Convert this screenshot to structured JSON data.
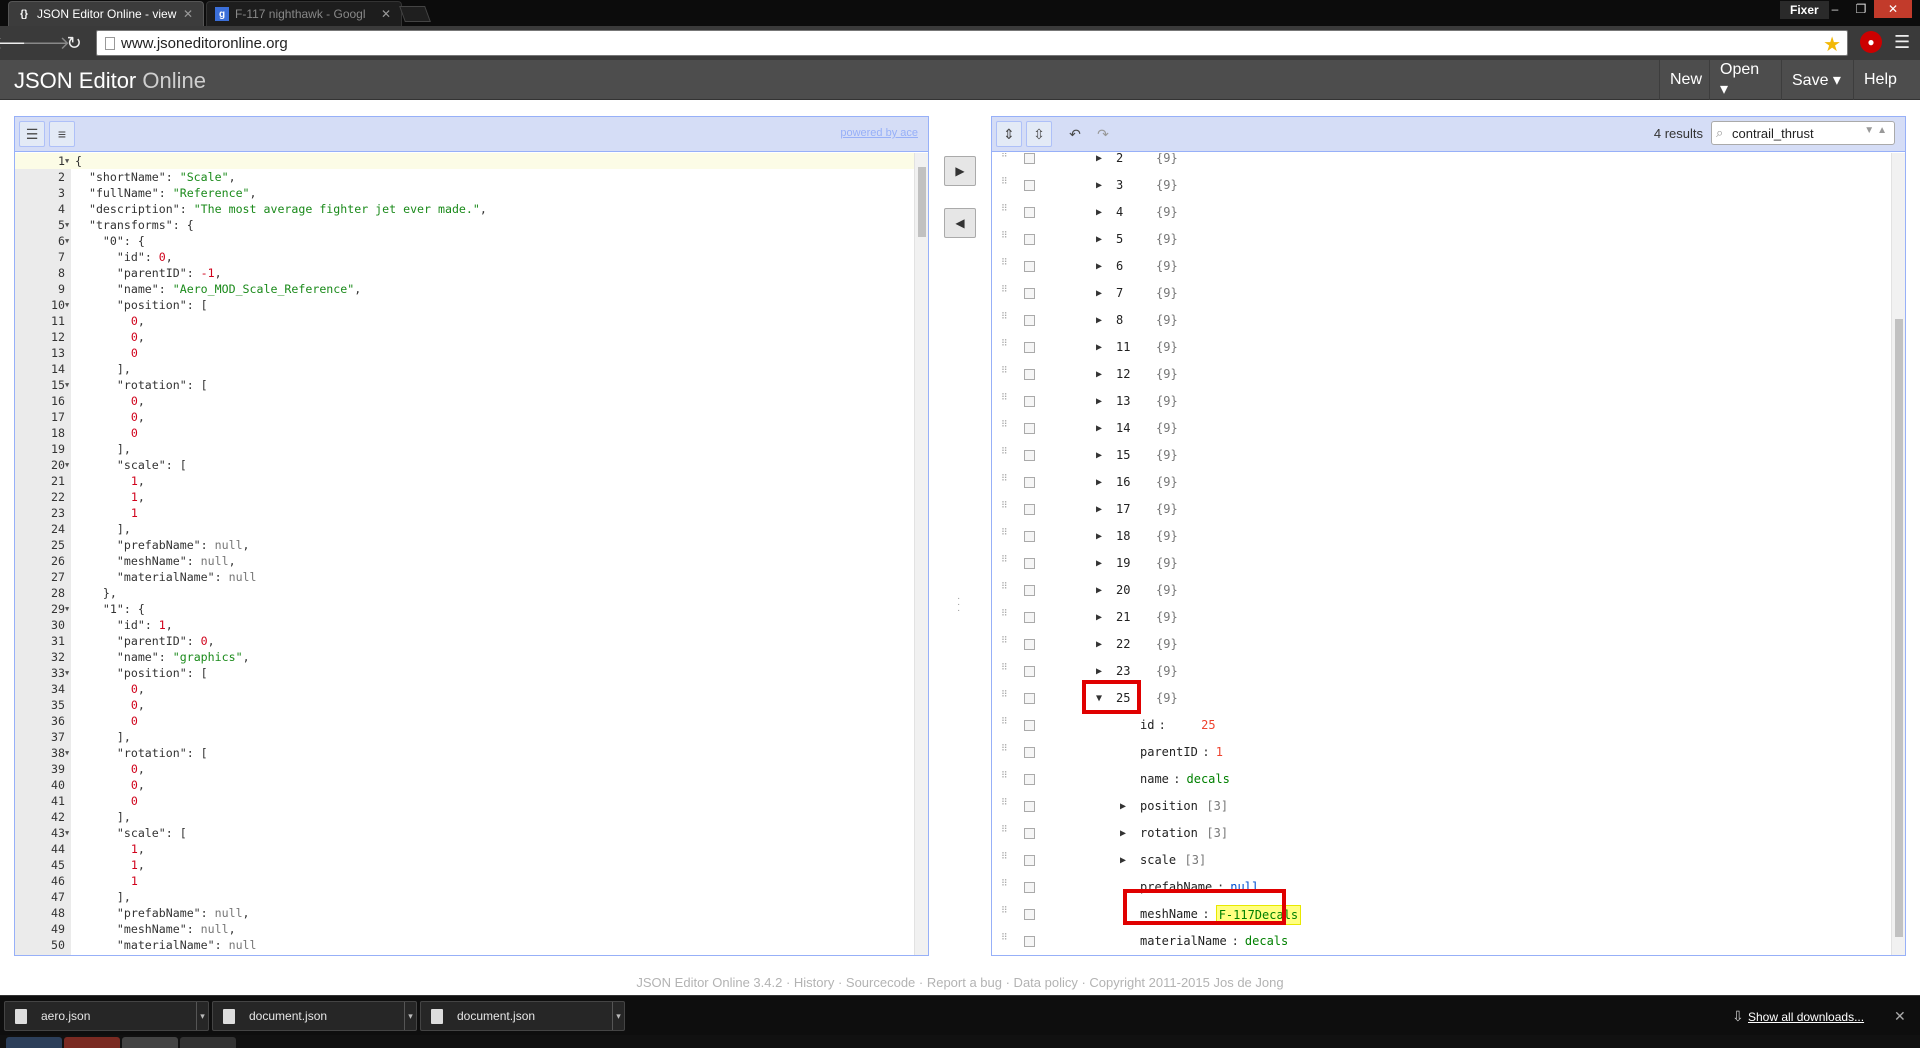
{
  "browser": {
    "tabs": [
      {
        "title": "JSON Editor Online - view",
        "favicon": "{}",
        "active": true
      },
      {
        "title": "F-117 nighthawk - Googl",
        "favicon": "g",
        "active": false
      }
    ],
    "profile": "Fixer",
    "url": "www.jsoneditoronline.org"
  },
  "app": {
    "title_main": "JSON Editor",
    "title_sub": "Online",
    "menu": {
      "new": "New",
      "open": "Open ▾",
      "save": "Save ▾",
      "help": "Help"
    }
  },
  "code_editor": {
    "powered_by": "powered by ace",
    "lines": [
      [
        [
          "p",
          "{"
        ]
      ],
      [
        [
          "p",
          "  "
        ],
        [
          "k",
          "\"shortName\""
        ],
        [
          "p",
          ": "
        ],
        [
          "s",
          "\"Scale\""
        ],
        [
          "p",
          ","
        ]
      ],
      [
        [
          "p",
          "  "
        ],
        [
          "k",
          "\"fullName\""
        ],
        [
          "p",
          ": "
        ],
        [
          "s",
          "\"Reference\""
        ],
        [
          "p",
          ","
        ]
      ],
      [
        [
          "p",
          "  "
        ],
        [
          "k",
          "\"description\""
        ],
        [
          "p",
          ": "
        ],
        [
          "s",
          "\"The most average fighter jet ever made.\""
        ],
        [
          "p",
          ","
        ]
      ],
      [
        [
          "p",
          "  "
        ],
        [
          "k",
          "\"transforms\""
        ],
        [
          "p",
          ": {"
        ]
      ],
      [
        [
          "p",
          "    "
        ],
        [
          "k",
          "\"0\""
        ],
        [
          "p",
          ": {"
        ]
      ],
      [
        [
          "p",
          "      "
        ],
        [
          "k",
          "\"id\""
        ],
        [
          "p",
          ": "
        ],
        [
          "n",
          "0"
        ],
        [
          "p",
          ","
        ]
      ],
      [
        [
          "p",
          "      "
        ],
        [
          "k",
          "\"parentID\""
        ],
        [
          "p",
          ": "
        ],
        [
          "n",
          "-1"
        ],
        [
          "p",
          ","
        ]
      ],
      [
        [
          "p",
          "      "
        ],
        [
          "k",
          "\"name\""
        ],
        [
          "p",
          ": "
        ],
        [
          "s",
          "\"Aero_MOD_Scale_Reference\""
        ],
        [
          "p",
          ","
        ]
      ],
      [
        [
          "p",
          "      "
        ],
        [
          "k",
          "\"position\""
        ],
        [
          "p",
          ": ["
        ]
      ],
      [
        [
          "p",
          "        "
        ],
        [
          "n",
          "0"
        ],
        [
          "p",
          ","
        ]
      ],
      [
        [
          "p",
          "        "
        ],
        [
          "n",
          "0"
        ],
        [
          "p",
          ","
        ]
      ],
      [
        [
          "p",
          "        "
        ],
        [
          "n",
          "0"
        ]
      ],
      [
        [
          "p",
          "      ],"
        ]
      ],
      [
        [
          "p",
          "      "
        ],
        [
          "k",
          "\"rotation\""
        ],
        [
          "p",
          ": ["
        ]
      ],
      [
        [
          "p",
          "        "
        ],
        [
          "n",
          "0"
        ],
        [
          "p",
          ","
        ]
      ],
      [
        [
          "p",
          "        "
        ],
        [
          "n",
          "0"
        ],
        [
          "p",
          ","
        ]
      ],
      [
        [
          "p",
          "        "
        ],
        [
          "n",
          "0"
        ]
      ],
      [
        [
          "p",
          "      ],"
        ]
      ],
      [
        [
          "p",
          "      "
        ],
        [
          "k",
          "\"scale\""
        ],
        [
          "p",
          ": ["
        ]
      ],
      [
        [
          "p",
          "        "
        ],
        [
          "n",
          "1"
        ],
        [
          "p",
          ","
        ]
      ],
      [
        [
          "p",
          "        "
        ],
        [
          "n",
          "1"
        ],
        [
          "p",
          ","
        ]
      ],
      [
        [
          "p",
          "        "
        ],
        [
          "n",
          "1"
        ]
      ],
      [
        [
          "p",
          "      ],"
        ]
      ],
      [
        [
          "p",
          "      "
        ],
        [
          "k",
          "\"prefabName\""
        ],
        [
          "p",
          ": "
        ],
        [
          "z",
          "null"
        ],
        [
          "p",
          ","
        ]
      ],
      [
        [
          "p",
          "      "
        ],
        [
          "k",
          "\"meshName\""
        ],
        [
          "p",
          ": "
        ],
        [
          "z",
          "null"
        ],
        [
          "p",
          ","
        ]
      ],
      [
        [
          "p",
          "      "
        ],
        [
          "k",
          "\"materialName\""
        ],
        [
          "p",
          ": "
        ],
        [
          "z",
          "null"
        ]
      ],
      [
        [
          "p",
          "    },"
        ]
      ],
      [
        [
          "p",
          "    "
        ],
        [
          "k",
          "\"1\""
        ],
        [
          "p",
          ": {"
        ]
      ],
      [
        [
          "p",
          "      "
        ],
        [
          "k",
          "\"id\""
        ],
        [
          "p",
          ": "
        ],
        [
          "n",
          "1"
        ],
        [
          "p",
          ","
        ]
      ],
      [
        [
          "p",
          "      "
        ],
        [
          "k",
          "\"parentID\""
        ],
        [
          "p",
          ": "
        ],
        [
          "n",
          "0"
        ],
        [
          "p",
          ","
        ]
      ],
      [
        [
          "p",
          "      "
        ],
        [
          "k",
          "\"name\""
        ],
        [
          "p",
          ": "
        ],
        [
          "s",
          "\"graphics\""
        ],
        [
          "p",
          ","
        ]
      ],
      [
        [
          "p",
          "      "
        ],
        [
          "k",
          "\"position\""
        ],
        [
          "p",
          ": ["
        ]
      ],
      [
        [
          "p",
          "        "
        ],
        [
          "n",
          "0"
        ],
        [
          "p",
          ","
        ]
      ],
      [
        [
          "p",
          "        "
        ],
        [
          "n",
          "0"
        ],
        [
          "p",
          ","
        ]
      ],
      [
        [
          "p",
          "        "
        ],
        [
          "n",
          "0"
        ]
      ],
      [
        [
          "p",
          "      ],"
        ]
      ],
      [
        [
          "p",
          "      "
        ],
        [
          "k",
          "\"rotation\""
        ],
        [
          "p",
          ": ["
        ]
      ],
      [
        [
          "p",
          "        "
        ],
        [
          "n",
          "0"
        ],
        [
          "p",
          ","
        ]
      ],
      [
        [
          "p",
          "        "
        ],
        [
          "n",
          "0"
        ],
        [
          "p",
          ","
        ]
      ],
      [
        [
          "p",
          "        "
        ],
        [
          "n",
          "0"
        ]
      ],
      [
        [
          "p",
          "      ],"
        ]
      ],
      [
        [
          "p",
          "      "
        ],
        [
          "k",
          "\"scale\""
        ],
        [
          "p",
          ": ["
        ]
      ],
      [
        [
          "p",
          "        "
        ],
        [
          "n",
          "1"
        ],
        [
          "p",
          ","
        ]
      ],
      [
        [
          "p",
          "        "
        ],
        [
          "n",
          "1"
        ],
        [
          "p",
          ","
        ]
      ],
      [
        [
          "p",
          "        "
        ],
        [
          "n",
          "1"
        ]
      ],
      [
        [
          "p",
          "      ],"
        ]
      ],
      [
        [
          "p",
          "      "
        ],
        [
          "k",
          "\"prefabName\""
        ],
        [
          "p",
          ": "
        ],
        [
          "z",
          "null"
        ],
        [
          "p",
          ","
        ]
      ],
      [
        [
          "p",
          "      "
        ],
        [
          "k",
          "\"meshName\""
        ],
        [
          "p",
          ": "
        ],
        [
          "z",
          "null"
        ],
        [
          "p",
          ","
        ]
      ],
      [
        [
          "p",
          "      "
        ],
        [
          "k",
          "\"materialName\""
        ],
        [
          "p",
          ": "
        ],
        [
          "z",
          "null"
        ]
      ]
    ],
    "foldable_lines": [
      1,
      5,
      6,
      10,
      15,
      20,
      29,
      33,
      38,
      43
    ]
  },
  "tree_editor": {
    "results": "4 results",
    "search_value": "contrail_thrust",
    "collapsed_nodes": [
      {
        "key": "2",
        "value": "{9}"
      },
      {
        "key": "3",
        "value": "{9}"
      },
      {
        "key": "4",
        "value": "{9}"
      },
      {
        "key": "5",
        "value": "{9}"
      },
      {
        "key": "6",
        "value": "{9}"
      },
      {
        "key": "7",
        "value": "{9}"
      },
      {
        "key": "8",
        "value": "{9}"
      },
      {
        "key": "11",
        "value": "{9}"
      },
      {
        "key": "12",
        "value": "{9}"
      },
      {
        "key": "13",
        "value": "{9}"
      },
      {
        "key": "14",
        "value": "{9}"
      },
      {
        "key": "15",
        "value": "{9}"
      },
      {
        "key": "16",
        "value": "{9}"
      },
      {
        "key": "17",
        "value": "{9}"
      },
      {
        "key": "18",
        "value": "{9}"
      },
      {
        "key": "19",
        "value": "{9}"
      },
      {
        "key": "20",
        "value": "{9}"
      },
      {
        "key": "21",
        "value": "{9}"
      },
      {
        "key": "22",
        "value": "{9}"
      },
      {
        "key": "23",
        "value": "{9}"
      }
    ],
    "expanded_node": {
      "key": "25",
      "value": "{9}",
      "children": [
        {
          "key": "id",
          "sep": "    :",
          "value": "25",
          "type": "number"
        },
        {
          "key": "parentID",
          "sep": ":",
          "value": "1",
          "type": "number"
        },
        {
          "key": "name",
          "sep": ":",
          "value": "decals",
          "type": "string"
        },
        {
          "key": "position",
          "value": "[3]",
          "type": "array"
        },
        {
          "key": "rotation",
          "value": "[3]",
          "type": "array"
        },
        {
          "key": "scale",
          "value": "[3]",
          "type": "array"
        },
        {
          "key": "prefabName",
          "sep": ":",
          "value": "null",
          "type": "null"
        },
        {
          "key": "meshName",
          "sep": ":",
          "value": "F-117Decals",
          "type": "string",
          "highlight": true
        },
        {
          "key": "materialName",
          "sep": ":",
          "value": "decals",
          "type": "string"
        }
      ]
    }
  },
  "footer": {
    "text": "JSON Editor Online 3.4.2 · History · Sourcecode · Report a bug · Data policy · Copyright 2011-2015 Jos de Jong"
  },
  "downloads": {
    "items": [
      "aero.json",
      "document.json",
      "document.json"
    ],
    "show_all": "Show all downloads..."
  },
  "colors": {
    "panel_border": "#97b0f8",
    "panel_menu": "#d5ddf6",
    "annotation_red": "#e00000",
    "highlight": "#ffff80"
  }
}
